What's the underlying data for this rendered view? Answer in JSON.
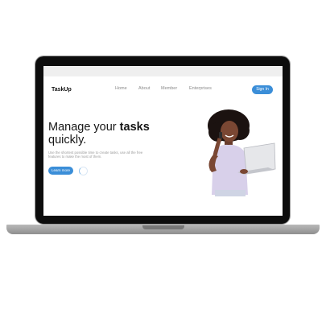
{
  "site": {
    "logo": "TaskUp",
    "nav": [
      "Home",
      "About",
      "Member",
      "Enterprises"
    ],
    "sign_in": "Sign In"
  },
  "hero": {
    "headline_prefix": "Manage your ",
    "headline_emphasis": "tasks",
    "headline_suffix": "quickly.",
    "subtext": "Use the shortest possible time to create tasks, use all the free features to make the most of them.",
    "cta": "Learn more"
  },
  "colors": {
    "accent": "#3b8ed8",
    "bezel": "#0d0d0d",
    "chassis": "#a5a5a5"
  },
  "icons": {
    "loading": "spinner-icon"
  }
}
